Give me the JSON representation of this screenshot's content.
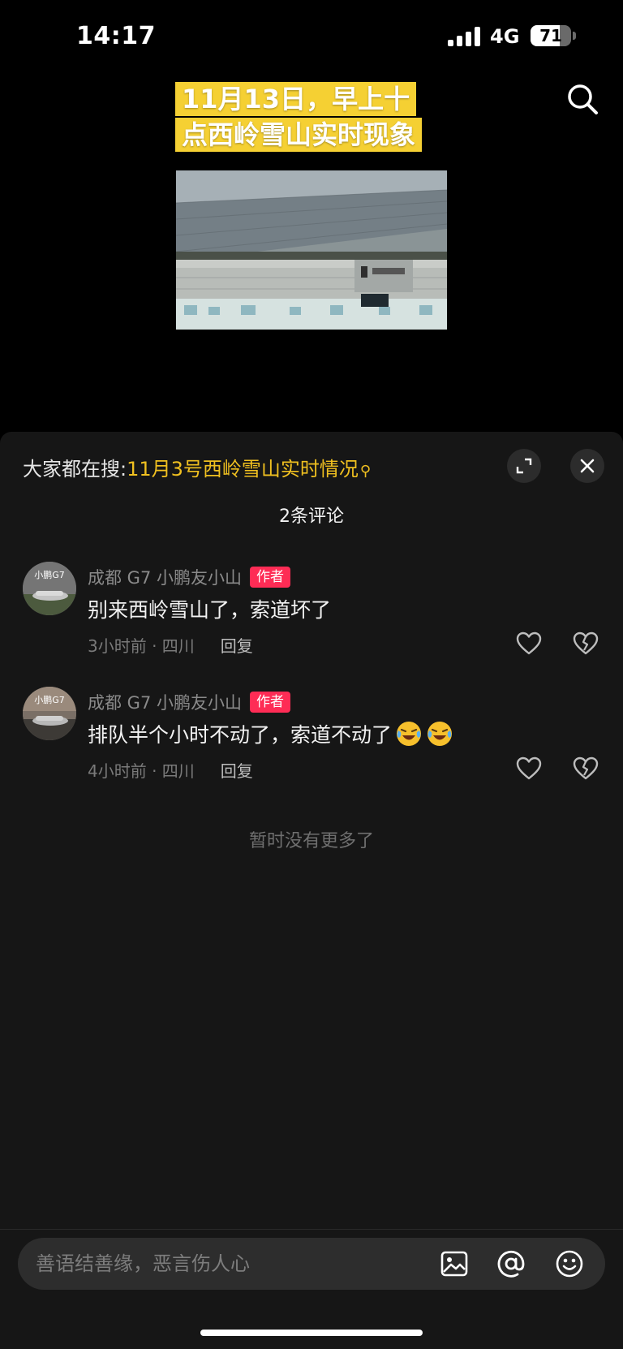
{
  "status": {
    "time": "14:17",
    "network": "4G",
    "battery": "71",
    "battery_level": 0.71
  },
  "video": {
    "title": "11月13日，早上十点西岭雪山实时现象"
  },
  "panel": {
    "trending_label": "大家都在搜:",
    "trending_keyword": "11月3号西岭雪山实时情况",
    "comment_count": "2条评论",
    "comments": [
      {
        "author": "成都 G7 小鹏友小山",
        "tag": "作者",
        "text": "别来西岭雪山了，索道坏了",
        "time_location": "3小时前 · 四川",
        "reply": "回复",
        "avatar_text": "小鹏G7"
      },
      {
        "author": "成都 G7 小鹏友小山",
        "tag": "作者",
        "text": "排队半个小时不动了，索道不动了",
        "time_location": "4小时前 · 四川",
        "reply": "回复",
        "avatar_text": "小鹏G7"
      }
    ],
    "no_more": "暂时没有更多了"
  },
  "input": {
    "placeholder": "善语结善缘，恶言伤人心"
  },
  "colors": {
    "accent_yellow": "#f0c020",
    "author_tag": "#fe2c55",
    "panel_bg": "#161616"
  }
}
